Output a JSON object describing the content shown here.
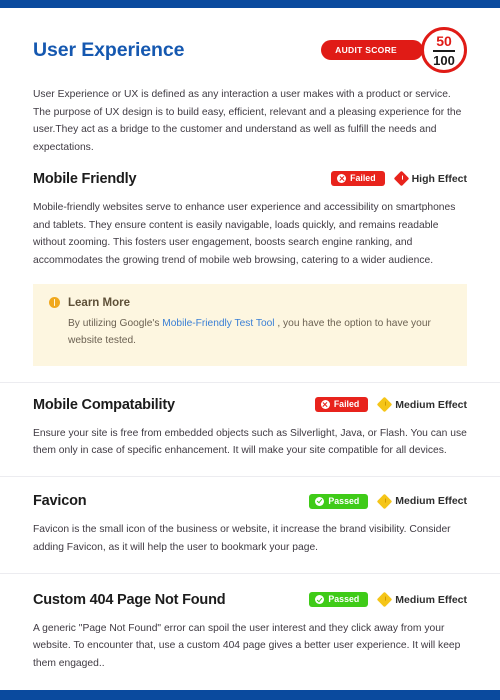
{
  "theme": {
    "bar_color": "#0a4a9e",
    "title_color": "#1558b0",
    "fail_color": "#e8231c",
    "pass_color": "#3fcb18",
    "high_effect_color": "#e8231c",
    "medium_effect_color": "#f5c518",
    "callout_bg": "#fdf6e0",
    "link_color": "#3a7fd5"
  },
  "header": {
    "title": "User Experience",
    "audit": {
      "label": "AUDIT SCORE",
      "score": "50",
      "total": "100"
    }
  },
  "intro": {
    "text": "User Experience or UX is defined as any interaction a user makes with a product or service. The purpose of UX design is to build easy, efficient, relevant and a pleasing experience for the user.They act as a bridge to the customer and understand as well as fulfill the needs and expectations."
  },
  "sections": [
    {
      "title": "Mobile Friendly",
      "status": "Failed",
      "status_type": "failed",
      "effect": "High Effect",
      "effect_type": "high",
      "body": "Mobile-friendly websites serve to enhance user experience and accessibility on smartphones and tablets. They ensure content is easily navigable, loads quickly, and remains readable without zooming. This fosters user engagement, boosts search engine ranking, and accommodates the growing trend of mobile web browsing, catering to a wider audience.",
      "callout": {
        "title": "Learn More",
        "text_before": "By utilizing Google's ",
        "link": "Mobile-Friendly Test Tool",
        "text_after": " , you have the option to have your website tested."
      }
    },
    {
      "title": "Mobile Compatability",
      "status": "Failed",
      "status_type": "failed",
      "effect": "Medium Effect",
      "effect_type": "medium",
      "body": "Ensure your site is free from embedded objects such as Silverlight, Java, or Flash. You can use them only in case of specific enhancement. It will make your site compatible for all devices."
    },
    {
      "title": "Favicon",
      "status": "Passed",
      "status_type": "passed",
      "effect": "Medium Effect",
      "effect_type": "medium",
      "body": "Favicon is the small icon of the business or website, it increase the brand visibility. Consider adding Favicon, as it will help the user to bookmark your page."
    },
    {
      "title": "Custom 404 Page Not Found",
      "status": "Passed",
      "status_type": "passed",
      "effect": "Medium Effect",
      "effect_type": "medium",
      "body": "A generic \"Page Not Found\" error can spoil the user interest and they click away from your website. To encounter that, use a custom 404 page gives a better user experience. It will keep them engaged.."
    }
  ]
}
